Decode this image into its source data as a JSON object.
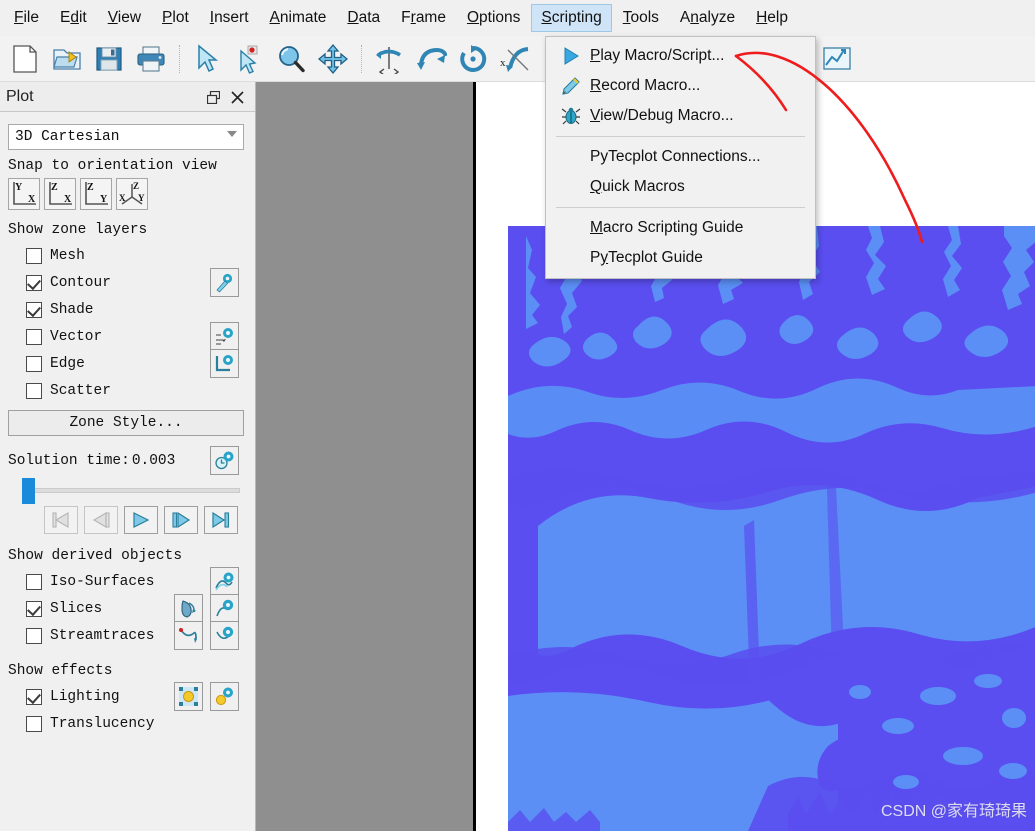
{
  "menubar": {
    "items": [
      {
        "label": "File",
        "mnemonic": "F",
        "active": false
      },
      {
        "label": "Edit",
        "mnemonic": "E",
        "active": false
      },
      {
        "label": "View",
        "mnemonic": "V",
        "active": false
      },
      {
        "label": "Plot",
        "mnemonic": "P",
        "active": false
      },
      {
        "label": "Insert",
        "mnemonic": "I",
        "active": false
      },
      {
        "label": "Animate",
        "mnemonic": "A",
        "active": false
      },
      {
        "label": "Data",
        "mnemonic": "D",
        "active": false
      },
      {
        "label": "Frame",
        "mnemonic": "r",
        "active": false
      },
      {
        "label": "Options",
        "mnemonic": "O",
        "active": false
      },
      {
        "label": "Scripting",
        "mnemonic": "S",
        "active": true
      },
      {
        "label": "Tools",
        "mnemonic": "T",
        "active": false
      },
      {
        "label": "Analyze",
        "mnemonic": "n",
        "active": false
      },
      {
        "label": "Help",
        "mnemonic": "H",
        "active": false
      }
    ]
  },
  "toolbar": {
    "buttons": [
      {
        "name": "new-file-icon",
        "selected": false
      },
      {
        "name": "open-file-icon",
        "selected": false
      },
      {
        "name": "save-file-icon",
        "selected": false
      },
      {
        "name": "print-icon",
        "selected": false
      },
      {
        "name": "separator",
        "selected": false
      },
      {
        "name": "select-arrow-icon",
        "selected": false
      },
      {
        "name": "pick-point-icon",
        "selected": false
      },
      {
        "name": "zoom-magnifier-icon",
        "selected": false
      },
      {
        "name": "pan-move-icon",
        "selected": false
      },
      {
        "name": "separator",
        "selected": false
      },
      {
        "name": "rotate-spin-icon",
        "selected": false
      },
      {
        "name": "rotate-twist-icon",
        "selected": false
      },
      {
        "name": "rotate-roll-icon",
        "selected": false
      },
      {
        "name": "rotate-x-axis-icon",
        "selected": false
      },
      {
        "name": "rotate-y-axis-icon",
        "selected": false
      },
      {
        "name": "rotate-z-axis-icon",
        "selected": false
      },
      {
        "name": "separator",
        "selected": false
      },
      {
        "name": "contour-label-icon",
        "selected": false
      },
      {
        "name": "probe-grid-icon",
        "selected": true
      },
      {
        "name": "formula-fx-icon",
        "selected": false
      },
      {
        "name": "separator",
        "selected": false
      },
      {
        "name": "text-tool-icon",
        "selected": false
      },
      {
        "name": "chart-insert-icon",
        "selected": false
      }
    ]
  },
  "dropdown": {
    "owner": "Scripting",
    "items": [
      {
        "label": "Play Macro/Script...",
        "mnemonic": "P",
        "icon": "play-triangle-icon",
        "type": "item"
      },
      {
        "label": "Record Macro...",
        "mnemonic": "R",
        "icon": "pencil-icon",
        "type": "item"
      },
      {
        "label": "View/Debug Macro...",
        "mnemonic": "V",
        "icon": "bug-icon",
        "type": "item"
      },
      {
        "type": "separator"
      },
      {
        "label": "PyTecplot Connections...",
        "mnemonic": "",
        "icon": "",
        "type": "item"
      },
      {
        "label": "Quick Macros",
        "mnemonic": "Q",
        "icon": "",
        "type": "item"
      },
      {
        "type": "separator"
      },
      {
        "label": "Macro Scripting Guide",
        "mnemonic": "M",
        "icon": "",
        "type": "item"
      },
      {
        "label": "PyTecplot Guide",
        "mnemonic": "y",
        "icon": "",
        "type": "item"
      }
    ]
  },
  "panel": {
    "title": "Plot",
    "restore_glyph": "❐",
    "close_glyph": "✕",
    "plot_type": "3D Cartesian",
    "orientation": {
      "label": "Snap to orientation view",
      "buttons": [
        {
          "name": "snap-view-yx",
          "top": "Y",
          "bottom": "X"
        },
        {
          "name": "snap-view-zx",
          "top": "Z",
          "bottom": "X"
        },
        {
          "name": "snap-view-zy",
          "top": "Z",
          "bottom": "Y"
        },
        {
          "name": "snap-view-xyz",
          "top": "Z",
          "bottom": "X Y"
        }
      ]
    },
    "zone_layers": {
      "label": "Show zone layers",
      "items": [
        {
          "label": "Mesh",
          "checked": false,
          "config": false
        },
        {
          "label": "Contour",
          "checked": true,
          "config": true,
          "config_icon": "contour-settings-icon"
        },
        {
          "label": "Shade",
          "checked": true,
          "config": false
        },
        {
          "label": "Vector",
          "checked": false,
          "config": true,
          "config_icon": "vector-settings-icon"
        },
        {
          "label": "Edge",
          "checked": false,
          "config": true,
          "config_icon": "edge-settings-icon"
        },
        {
          "label": "Scatter",
          "checked": false,
          "config": false
        }
      ],
      "zone_style_button": "Zone Style..."
    },
    "solution_time": {
      "label": "Solution time:",
      "value": "0.003",
      "config_icon": "time-settings-icon",
      "slider_percent": 0,
      "playback": [
        {
          "name": "skip-to-start-button",
          "glyph": "skip-back",
          "disabled": true
        },
        {
          "name": "step-back-button",
          "glyph": "step-back",
          "disabled": true
        },
        {
          "name": "play-button",
          "glyph": "play",
          "disabled": false
        },
        {
          "name": "step-forward-button",
          "glyph": "step-forward",
          "disabled": false
        },
        {
          "name": "skip-to-end-button",
          "glyph": "skip-forward",
          "disabled": false
        }
      ]
    },
    "derived_objects": {
      "label": "Show derived objects",
      "items": [
        {
          "label": "Iso-Surfaces",
          "checked": false,
          "extra": false,
          "config": true,
          "config_icon": "isosurface-settings-icon"
        },
        {
          "label": "Slices",
          "checked": true,
          "extra": true,
          "extra_icon": "slice-tool-icon",
          "config": true,
          "config_icon": "slice-settings-icon"
        },
        {
          "label": "Streamtraces",
          "checked": false,
          "extra": true,
          "extra_icon": "streamtrace-tool-icon",
          "config": true,
          "config_icon": "streamtrace-settings-icon"
        }
      ]
    },
    "effects": {
      "label": "Show effects",
      "items": [
        {
          "label": "Lighting",
          "checked": true,
          "extra": true,
          "extra_icon": "light-source-icon",
          "config": true,
          "config_icon": "lighting-settings-icon"
        },
        {
          "label": "Translucency",
          "checked": false,
          "extra": false,
          "config": false
        }
      ]
    }
  },
  "workspace": {
    "background_color": "#8f8f8f",
    "canvas_color": "#ffffff",
    "watermark": "CSDN @家有琦琦果"
  },
  "plot": {
    "description": "3D Cartesian contour slice flood plot, two-band blue colormap",
    "colors": {
      "band_light": "#5b8ff5",
      "band_deep": "#5a4ef0",
      "band_mid": "#4e79f0"
    }
  },
  "annotation": {
    "arrow_color": "#ee1c1c",
    "description": "hand drawn red arrow pointing at Play Macro/Script..."
  }
}
